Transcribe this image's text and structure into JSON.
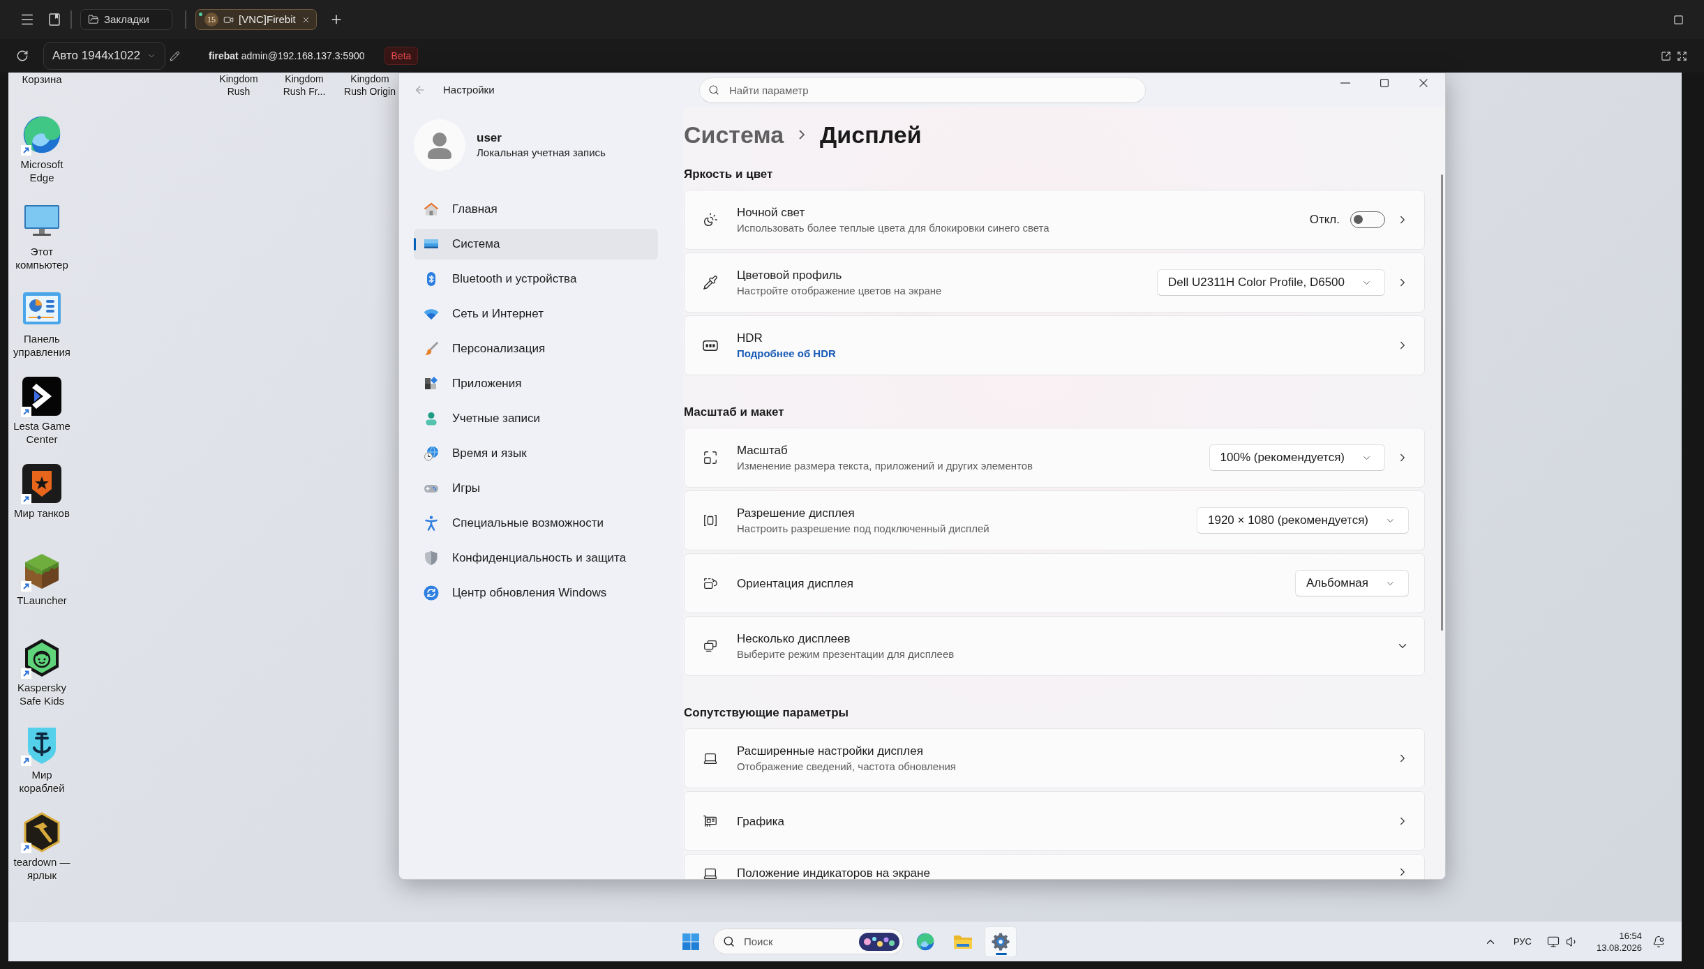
{
  "browser": {
    "bookmarks_button": "Закладки",
    "tabs": [
      {
        "badge": "15",
        "title": "[VNC]Firebit",
        "selected": true
      }
    ],
    "display_mode": "Авто 1944x1022",
    "connection": "**firebat** admin@192.168.137.3:5900",
    "status_badge": "Beta"
  },
  "desktop": {
    "column_top_label": "Корзина",
    "row_top_labels": [
      "Kingdom Rush",
      "Kingdom Rush Fr...",
      "Kingdom Rush Origin"
    ],
    "icons": [
      {
        "kind": "edge",
        "label": "Microsoft Edge",
        "shortcut": true
      },
      {
        "kind": "computer",
        "label": "Этот компьютер",
        "shortcut": false
      },
      {
        "kind": "control_panel",
        "label": "Панель управления",
        "shortcut": false
      },
      {
        "kind": "lesta",
        "label": "Lesta Game Center",
        "shortcut": true
      },
      {
        "kind": "tanks",
        "label": "Мир танков",
        "shortcut": true
      },
      {
        "kind": "tlauncher",
        "label": "TLauncher",
        "shortcut": true
      },
      {
        "kind": "kaspersky",
        "label": "Kaspersky Safe Kids",
        "shortcut": true
      },
      {
        "kind": "ships",
        "label": "Мир кораблей",
        "shortcut": true
      },
      {
        "kind": "teardown",
        "label": "teardown — ярлык",
        "shortcut": true
      }
    ]
  },
  "settings_window": {
    "title": "Настройки",
    "search": {
      "placeholder": "Найти параметр"
    },
    "account": {
      "name": "user",
      "type": "Локальная учетная запись"
    },
    "nav": [
      {
        "label": "Главная",
        "selected": false
      },
      {
        "label": "Система",
        "selected": true
      },
      {
        "label": "Bluetooth и устройства",
        "selected": false
      },
      {
        "label": "Сеть и Интернет",
        "selected": false
      },
      {
        "label": "Персонализация",
        "selected": false
      },
      {
        "label": "Приложения",
        "selected": false
      },
      {
        "label": "Учетные записи",
        "selected": false
      },
      {
        "label": "Время и язык",
        "selected": false
      },
      {
        "label": "Игры",
        "selected": false
      },
      {
        "label": "Специальные возможности",
        "selected": false
      },
      {
        "label": "Конфиденциальность и защита",
        "selected": false
      },
      {
        "label": "Центр обновления Windows",
        "selected": false
      }
    ],
    "breadcrumb": {
      "parent": "Система",
      "current": "Дисплей"
    },
    "sections": [
      {
        "heading": "Яркость и цвет",
        "items": [
          {
            "kind": "toggle",
            "title": "Ночной свет",
            "description": "Использовать более теплые цвета для блокировки синего света",
            "state_label": "Откл.",
            "on": false,
            "has_subpage": true
          },
          {
            "kind": "dropdown",
            "title": "Цветовой профиль",
            "description": "Настройте отображение цветов на экране",
            "value": "Dell U2311H Color Profile, D6500",
            "has_subpage": true
          },
          {
            "kind": "link",
            "title": "HDR",
            "link": "Подробнее об HDR",
            "has_subpage": true
          }
        ]
      },
      {
        "heading": "Масштаб и макет",
        "items": [
          {
            "kind": "dropdown",
            "title": "Масштаб",
            "description": "Изменение размера текста, приложений и других элементов",
            "value": "100% (рекомендуется)",
            "has_subpage": true
          },
          {
            "kind": "dropdown",
            "title": "Разрешение дисплея",
            "description": "Настроить разрешение под подключенный дисплей",
            "value": "1920 × 1080 (рекомендуется)",
            "has_subpage": false
          },
          {
            "kind": "dropdown",
            "title": "Ориентация дисплея",
            "value": "Альбомная",
            "has_subpage": false
          },
          {
            "kind": "expander",
            "title": "Несколько дисплеев",
            "description": "Выберите режим презентации для дисплеев",
            "expanded": false
          }
        ]
      },
      {
        "heading": "Сопутствующие параметры",
        "items": [
          {
            "kind": "plain",
            "title": "Расширенные настройки дисплея",
            "description": "Отображение сведений, частота обновления",
            "has_subpage": true
          },
          {
            "kind": "plain",
            "title": "Графика",
            "has_subpage": true
          },
          {
            "kind": "plain",
            "title": "Положение индикаторов на экране",
            "has_subpage": true
          }
        ]
      }
    ]
  },
  "taskbar": {
    "search": {
      "placeholder": "Поиск"
    },
    "apps": [
      {
        "active": false
      },
      {
        "active": false
      },
      {
        "active": true
      }
    ],
    "tray": {
      "language": "РУС",
      "time": "16:54",
      "date": "13.08.2026"
    }
  }
}
